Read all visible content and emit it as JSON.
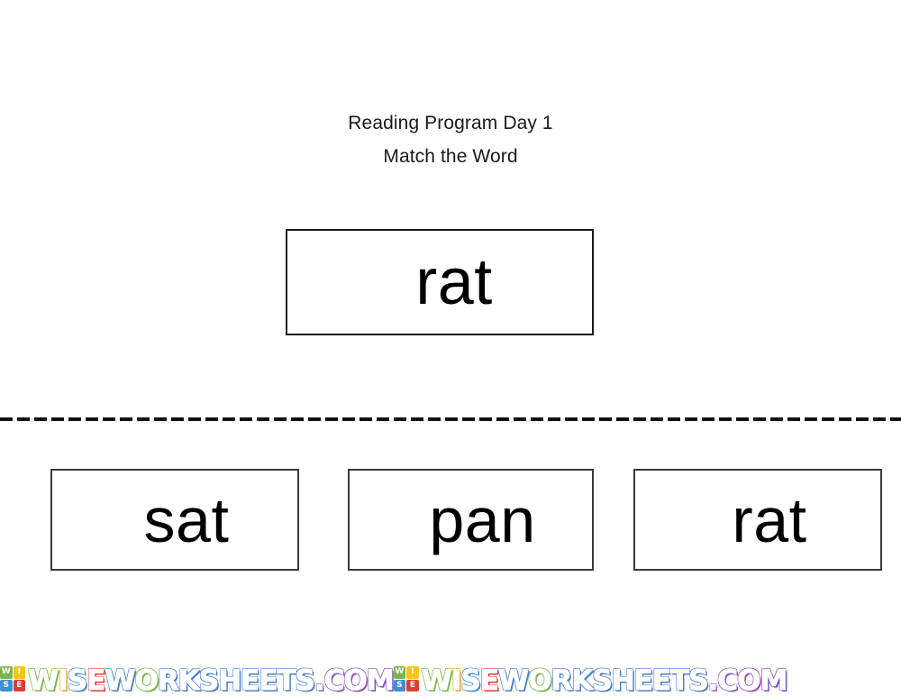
{
  "worksheet": {
    "title_line_1": "Reading Program Day 1",
    "title_line_2": "Match the Word",
    "prompt_word": "rat",
    "choices": [
      {
        "word": "sat"
      },
      {
        "word": "pan"
      },
      {
        "word": "rat"
      }
    ]
  },
  "watermark": {
    "badge_letters": [
      "W",
      "I",
      "S",
      "E"
    ],
    "badge_colors": [
      "#7ab648",
      "#f5c518",
      "#3f8fd4",
      "#e03c31"
    ],
    "wordmark": "WISEWORKSHEETS.COM",
    "wordmark_letters": [
      {
        "ch": "W",
        "color": "#7ab648"
      },
      {
        "ch": "I",
        "color": "#f0a020"
      },
      {
        "ch": "S",
        "color": "#3f8fd4"
      },
      {
        "ch": "E",
        "color": "#e03c31"
      },
      {
        "ch": "W",
        "color": "#4a7fd0"
      },
      {
        "ch": "O",
        "color": "#7ab648"
      },
      {
        "ch": "R",
        "color": "#4a7fd0"
      },
      {
        "ch": "K",
        "color": "#4a7fd0"
      },
      {
        "ch": "S",
        "color": "#4a7fd0"
      },
      {
        "ch": "H",
        "color": "#4a7fd0"
      },
      {
        "ch": "E",
        "color": "#4a7fd0"
      },
      {
        "ch": "E",
        "color": "#4a7fd0"
      },
      {
        "ch": "T",
        "color": "#4a7fd0"
      },
      {
        "ch": "S",
        "color": "#5b7fd0"
      },
      {
        "ch": ".",
        "color": "#8a5fc0"
      },
      {
        "ch": "C",
        "color": "#8a5fc0"
      },
      {
        "ch": "O",
        "color": "#9b52b8"
      },
      {
        "ch": "M",
        "color": "#7b4fc0"
      }
    ],
    "repeat_count": 2
  },
  "colors": {
    "page_background": "#ffffff",
    "box_border": "#1a1a1a",
    "choice_border": "#3a3a3a",
    "text": "#000000",
    "cut_line": "#111111"
  }
}
